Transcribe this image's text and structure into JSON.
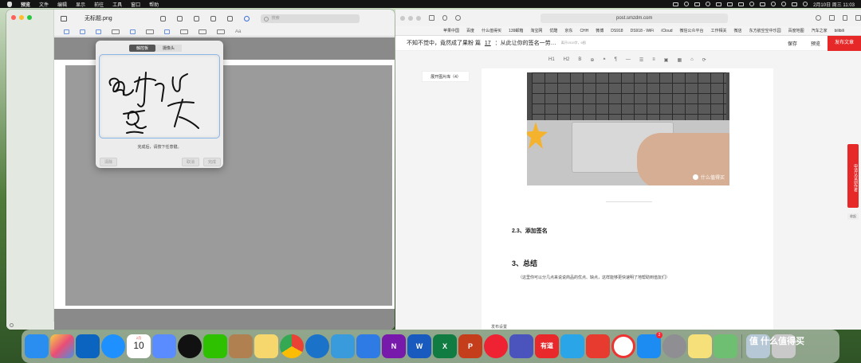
{
  "menubar": {
    "app_menus": [
      "预览",
      "文件",
      "编辑",
      "显示",
      "前往",
      "工具",
      "窗口",
      "帮助"
    ],
    "clock": "2月10日 周三 11:03"
  },
  "preview": {
    "title": "无标题.png",
    "search_placeholder": "搜索",
    "text_format_label": "Aa",
    "signature": {
      "tabs": [
        "触控板",
        "摄像头"
      ],
      "active_tab": 0,
      "hint": "完成后，请按下任意键。",
      "clear_button": "清除",
      "cancel_button": "取消",
      "done_button": "完成"
    }
  },
  "safari": {
    "url": "post.smzdm.com",
    "bookmarks": [
      "苹果中国",
      "百度",
      "什么值得买",
      "139邮箱",
      "淘宝网",
      "优酷",
      "京东",
      "CHH",
      "微博",
      "DS918",
      "DS918 - WiFi",
      "iCloud",
      "微信公众平台",
      "工作相关",
      "微店",
      "东方航空空中乐园",
      "百度地图",
      "汽车之家",
      "bilibili"
    ]
  },
  "editor": {
    "title": "不知不觉中，竟然成了果粉 篇",
    "series_number": "17",
    "title_suffix": "：从此让你的签名一劳…",
    "meta": "离开1919字，6图",
    "save_label": "保存",
    "preview_label": "预览",
    "publish_label": "发布文章",
    "format_tools": [
      "H1",
      "H2",
      "B",
      "⊕",
      "❝",
      "¶",
      "—",
      "☰",
      "≡",
      "▣",
      "▦",
      "⌂",
      "⟳"
    ],
    "gallery_button": "展开图片库（4）",
    "photo_watermark": "什么值得买",
    "heading_sign": "2.3、添加签名",
    "heading_summary": "3、总结",
    "summary_text": "（这里你可以分几点来说说商品的优点、缺点，这样能够更快速明了地帮助到值友们）",
    "footer_label": "发布设置",
    "side_tab": "申请认证创作者",
    "side_small": "收起"
  },
  "dock": {
    "calendar_month": "2月",
    "calendar_day": "10",
    "word_letter": "W",
    "excel_letter": "X",
    "ppt_letter": "P",
    "onenote_letter": "N",
    "youdao_label": "有道",
    "appstore_badge": "2",
    "brand": "值 什么值得买"
  },
  "colors": {
    "publish_red": "#e62828",
    "accent_blue": "#3a6fd8"
  }
}
